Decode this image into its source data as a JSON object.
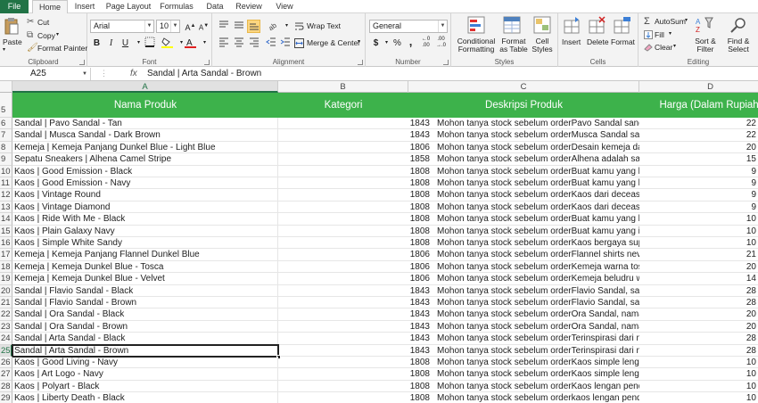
{
  "tabs": [
    "File",
    "Home",
    "Insert",
    "Page Layout",
    "Formulas",
    "Data",
    "Review",
    "View"
  ],
  "active_tab": "Home",
  "ribbon": {
    "clipboard": {
      "label": "Clipboard",
      "paste": "Paste",
      "cut": "Cut",
      "copy": "Copy",
      "format_painter": "Format Painter"
    },
    "font": {
      "label": "Font",
      "font_name": "Arial",
      "font_size": "10",
      "bold": "B",
      "italic": "I",
      "underline": "U"
    },
    "alignment": {
      "label": "Alignment",
      "wrap_text": "Wrap Text",
      "merge_center": "Merge & Center"
    },
    "number": {
      "label": "Number",
      "format": "General",
      "currency": "$",
      "percent": "%",
      "comma": ","
    },
    "styles": {
      "label": "Styles",
      "conditional": "Conditional Formatting",
      "format_table": "Format as Table",
      "cell_styles": "Cell Styles"
    },
    "cells": {
      "label": "Cells",
      "insert": "Insert",
      "delete": "Delete",
      "format": "Format"
    },
    "editing": {
      "label": "Editing",
      "autosum": "AutoSum",
      "fill": "Fill",
      "clear": "Clear",
      "sort_filter": "Sort & Filter",
      "find_select": "Find & Select"
    }
  },
  "formula_bar": {
    "name_box": "A25",
    "fx": "fx",
    "content": "Sandal | Arta Sandal - Brown"
  },
  "columns": [
    "A",
    "B",
    "C",
    "D"
  ],
  "selected_column": "A",
  "header_row": {
    "row_num": "5",
    "cells": [
      "Nama Produk",
      "Kategori",
      "Deskripsi Produk",
      "Harga (Dalam Rupiah)"
    ]
  },
  "selected_row": "25",
  "rows": [
    {
      "num": "6",
      "nama": "Sandal | Pavo Sandal - Tan",
      "kat": "1843",
      "desk": "Mohon tanya stock sebelum orderPavo Sandal sangat nyaman dig",
      "harga": "22"
    },
    {
      "num": "7",
      "nama": "Sandal | Musca Sandal - Dark Brown",
      "kat": "1843",
      "desk": "Mohon tanya stock sebelum orderMusca Sandal sangat nyaman d",
      "harga": "22"
    },
    {
      "num": "8",
      "nama": "Kemeja | Kemeja Panjang Dunkel Blue - Light Blue",
      "kat": "1806",
      "desk": "Mohon tanya stock sebelum orderDesain kemeja dari dunkelblue y",
      "harga": "20"
    },
    {
      "num": "9",
      "nama": "Sepatu Sneakers | Alhena Camel Stripe",
      "kat": "1858",
      "desk": "Mohon tanya stock sebelum orderAlhena adalah salah satu sepat",
      "harga": "15"
    },
    {
      "num": "10",
      "nama": "Kaos | Good Emission - Black",
      "kat": "1808",
      "desk": "Mohon tanya stock sebelum orderBuat kamu yang hobby gowes a",
      "harga": "9"
    },
    {
      "num": "11",
      "nama": "Kaos | Good Emission - Navy",
      "kat": "1808",
      "desk": "Mohon tanya stock sebelum orderBuat kamu yang hobby gowes a",
      "harga": "9"
    },
    {
      "num": "12",
      "nama": "Kaos | Vintage Round",
      "kat": "1808",
      "desk": "Mohon tanya stock sebelum orderKaos dari decease of lame ini co",
      "harga": "9"
    },
    {
      "num": "13",
      "nama": "Kaos | Vintage Diamond",
      "kat": "1808",
      "desk": "Mohon tanya stock sebelum orderKaos dari decease of lame deng",
      "harga": "9"
    },
    {
      "num": "14",
      "nama": "Kaos | Ride With Me - Black",
      "kat": "1808",
      "desk": "Mohon tanya stock sebelum orderBuat kamu yang hobby gowes a",
      "harga": "10"
    },
    {
      "num": "15",
      "nama": "Kaos | Plain Galaxy Navy",
      "kat": "1808",
      "desk": "Mohon tanya stock sebelum orderBuat kamu yang ingin bergaya s",
      "harga": "10"
    },
    {
      "num": "16",
      "nama": "Kaos | Simple White Sandy",
      "kat": "1808",
      "desk": "Mohon tanya stock sebelum orderKaos bergaya super simple yet s",
      "harga": "10"
    },
    {
      "num": "17",
      "nama": "Kemeja | Kemeja Panjang Flannel Dunkel Blue",
      "kat": "1806",
      "desk": "Mohon tanya stock sebelum orderFlannel shirts never looks old, ga",
      "harga": "21"
    },
    {
      "num": "18",
      "nama": "Kemeja | Kemeja Dunkel Blue - Tosca",
      "kat": "1806",
      "desk": "Mohon tanya stock sebelum orderKemeja warna tosca dari dunkel",
      "harga": "20"
    },
    {
      "num": "19",
      "nama": "Kemeja | Kemeja Dunkel Blue - Velvet",
      "kat": "1806",
      "desk": "Mohon tanya stock sebelum orderKemeja beludru warna cokelat d",
      "harga": "14"
    },
    {
      "num": "20",
      "nama": "Sandal | Flavio Sandal - Black",
      "kat": "1843",
      "desk": "Mohon tanya stock sebelum orderFlavio Sandal, sandal ini sangat",
      "harga": "28"
    },
    {
      "num": "21",
      "nama": "Sandal | Flavio Sandal - Brown",
      "kat": "1843",
      "desk": "Mohon tanya stock sebelum orderFlavio Sandal, sandal ini sangat",
      "harga": "28"
    },
    {
      "num": "22",
      "nama": "Sandal | Ora Sandal - Black",
      "kat": "1843",
      "desk": "Mohon tanya stock sebelum orderOra Sandal, nama Ora terinspira",
      "harga": "20"
    },
    {
      "num": "23",
      "nama": "Sandal | Ora Sandal - Brown",
      "kat": "1843",
      "desk": "Mohon tanya stock sebelum orderOra Sandal, nama Ora terinspira",
      "harga": "20"
    },
    {
      "num": "24",
      "nama": "Sandal | Arta Sandal - Black",
      "kat": "1843",
      "desk": "Mohon tanya stock sebelum orderTerinspirasi dari nama pantai yar",
      "harga": "28"
    },
    {
      "num": "25",
      "nama": "Sandal | Arta Sandal - Brown",
      "kat": "1843",
      "desk": "Mohon tanya stock sebelum orderTerinspirasi dari nama pantai yar",
      "harga": "28"
    },
    {
      "num": "26",
      "nama": "Kaos | Good Living - Navy",
      "kat": "1808",
      "desk": "Mohon tanya stock sebelum orderKaos simple lengan pendek ngg",
      "harga": "10"
    },
    {
      "num": "27",
      "nama": "Kaos | Art Logo  - Navy",
      "kat": "1808",
      "desk": "Mohon tanya stock sebelum orderKaos simple lengan pendek ngg",
      "harga": "10"
    },
    {
      "num": "28",
      "nama": "Kaos | Polyart - Black",
      "kat": "1808",
      "desk": "Mohon tanya stock sebelum orderKaos lengan pendek dari artnom",
      "harga": "10"
    },
    {
      "num": "29",
      "nama": "Kaos | Liberty Death - Black",
      "kat": "1808",
      "desk": "Mohon tanya stock sebelum orderkaos lengan pendek dari artnom",
      "harga": "10"
    }
  ],
  "colors": {
    "header_green": "#3db24b",
    "excel_green": "#217346"
  }
}
